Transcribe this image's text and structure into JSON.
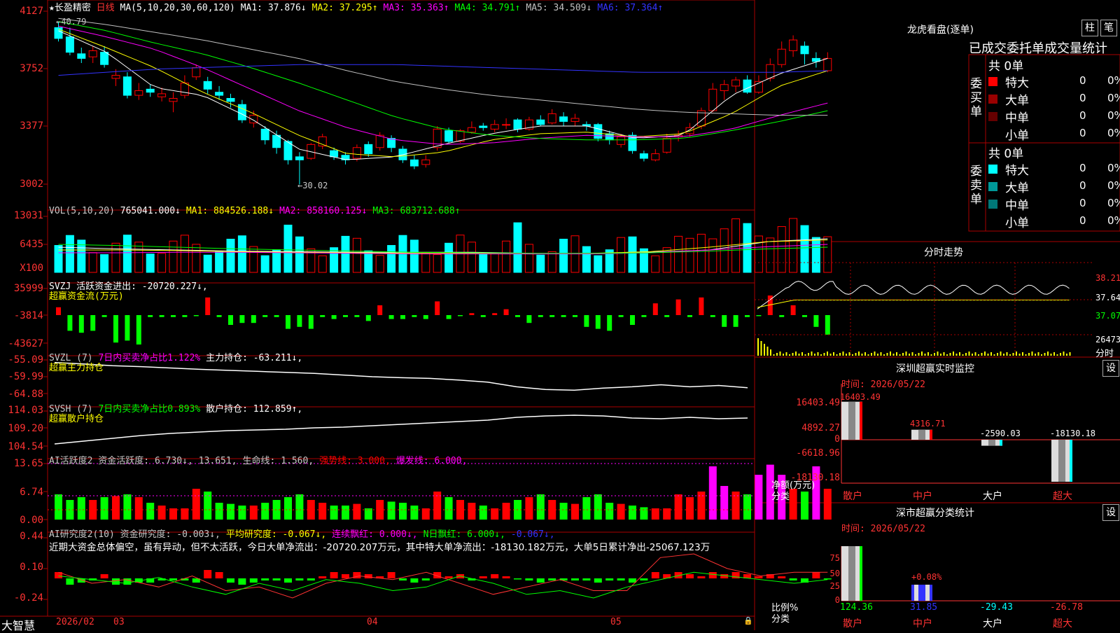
{
  "header": {
    "title": "★长盈精密",
    "period": "日线",
    "ma_params": "MA(5,10,20,30,60,120)",
    "ma": [
      {
        "text": "MA1: 37.876↓",
        "color": "#ffffff"
      },
      {
        "text": "MA2: 37.295↑",
        "color": "#ffff00"
      },
      {
        "text": "MA3: 35.363↑",
        "color": "#ff00ff"
      },
      {
        "text": "MA4: 34.791↑",
        "color": "#00ff00"
      },
      {
        "text": "MA5: 34.509↓",
        "color": "#c0c0c0"
      },
      {
        "text": "MA6: 37.364↑",
        "color": "#3333ff"
      }
    ]
  },
  "axis": {
    "price": [
      "4127",
      "3752",
      "3377",
      "3002"
    ],
    "vol": [
      "13031",
      "6435",
      "X100"
    ],
    "svzj": [
      "35999",
      "-3814",
      "-43627"
    ],
    "svzl": [
      "-55.09",
      "-59.99",
      "-64.88"
    ],
    "svsh": [
      "114.03",
      "109.20",
      "104.54"
    ],
    "ai1": [
      "13.65",
      "6.74",
      "0.00"
    ],
    "ai2": [
      "0.44",
      "0.10",
      "-0.24"
    ]
  },
  "annotations": {
    "high": "←40.79",
    "low": "←30.02"
  },
  "vol_header": {
    "name": "VOL(5,10,20)",
    "items": [
      {
        "text": "765041.000↓",
        "color": "#ffffff"
      },
      {
        "text": "MA1: 884526.188↓",
        "color": "#ffff00"
      },
      {
        "text": "MA2: 858160.125↓",
        "color": "#ff00ff"
      },
      {
        "text": "MA3: 683712.688↑",
        "color": "#00ff00"
      }
    ]
  },
  "svzj_header": {
    "line1": "SVZJ  活跃资金进出: -20720.227↓,",
    "line2": "超赢资金流(万元)"
  },
  "svzl_header": {
    "name": "SVZL (7)",
    "ratio": "7日内买卖净占比1.122%",
    "hold": "主力持仓: -63.211↓,",
    "line2": "超赢主力持仓"
  },
  "svsh_header": {
    "name": "SVSH (7)",
    "ratio": "7日内买卖净占比0.893%",
    "hold": "散户持仓: 112.859↑,",
    "line2": "超赢散户持仓"
  },
  "ai1_header": {
    "items": [
      {
        "text": "AI活跃度2 资金活跃度: 6.730↓,",
        "color": "#c8c8c8"
      },
      {
        "text": "13.651,",
        "color": "#c8c8c8"
      },
      {
        "text": "生命线: 1.560,",
        "color": "#c8c8c8"
      },
      {
        "text": "强势线: 3.000,",
        "color": "#ff0000"
      },
      {
        "text": "爆发线: 6.000,",
        "color": "#ff00ff"
      }
    ]
  },
  "ai2_header": {
    "items": [
      {
        "text": "AI研究度2(10) 资金研究度: -0.003↓,",
        "color": "#c8c8c8"
      },
      {
        "text": "平均研究度: -0.067↓,",
        "color": "#ffff00"
      },
      {
        "text": "连续飘红: 0.000↓,",
        "color": "#ff00ff"
      },
      {
        "text": "N日飘红: 6.000↓,",
        "color": "#00ff00"
      },
      {
        "text": "-0.067↓,",
        "color": "#3333ff"
      }
    ],
    "summary": "近期大资金总体偏空，虽有异动，但不太活跃，今日大单净流出：-20720.207万元，其中特大单净流出：-18130.182万元，大单5日累计净出-25067.123万"
  },
  "dates": [
    "2026/02",
    "03",
    "04",
    "05"
  ],
  "footer": {
    "brand": "大智慧"
  },
  "right": {
    "title": "龙虎看盘(逐单)",
    "btn_bar": "柱",
    "btn_pen": "笔",
    "subtitle": "已成交委托单成交量统计",
    "buy_label": "委买单",
    "sell_label": "委卖单",
    "buy_total": "共 0单",
    "sell_total": "共 0单",
    "buy_rows": [
      {
        "label": "特大",
        "value": "0",
        "pct": "0%",
        "color": "#ff0000"
      },
      {
        "label": "大单",
        "value": "0",
        "pct": "0%",
        "color": "#990000"
      },
      {
        "label": "中单",
        "value": "0",
        "pct": "0%",
        "color": "#660000"
      },
      {
        "label": "小单",
        "value": "0",
        "pct": "0%",
        "color": "#000000"
      }
    ],
    "sell_rows": [
      {
        "label": "特大",
        "value": "0",
        "pct": "0%",
        "color": "#00ffff"
      },
      {
        "label": "大单",
        "value": "0",
        "pct": "0%",
        "color": "#009999"
      },
      {
        "label": "中单",
        "value": "0",
        "pct": "0%",
        "color": "#007777"
      },
      {
        "label": "小单",
        "value": "0",
        "pct": "0%",
        "color": "#000000"
      }
    ],
    "intraday_title": "分时走势",
    "intraday_axis": [
      "38.21",
      "37.64",
      "37.07",
      "26473"
    ],
    "intraday_unit": "分时",
    "sz_monitor_title": "深圳超赢实时监控",
    "sz_monitor_time": "时间: 2026/05/22",
    "sz_monitor_axis": [
      "16403.49",
      "4892.27",
      "0",
      "-6618.96",
      "-18130.18"
    ],
    "sz_monitor_unit1": "净额(万元)",
    "sz_monitor_unit2": "分类",
    "settings": "设",
    "categories": [
      "散户",
      "中户",
      "大户",
      "超大"
    ],
    "net_values": [
      "16403.49",
      "4316.71",
      "-2590.03",
      "-18130.18"
    ],
    "cls_title": "深市超赢分类统计",
    "cls_time": "时间: 2026/05/22",
    "cls_axis": [
      "75",
      "50",
      "25",
      "0"
    ],
    "cls_unit1": "比例%",
    "cls_unit2": "分类",
    "cls_values": [
      "124.36",
      "31.85",
      "-29.43",
      "-26.78"
    ],
    "cls_extra": "+0.08%"
  }
}
